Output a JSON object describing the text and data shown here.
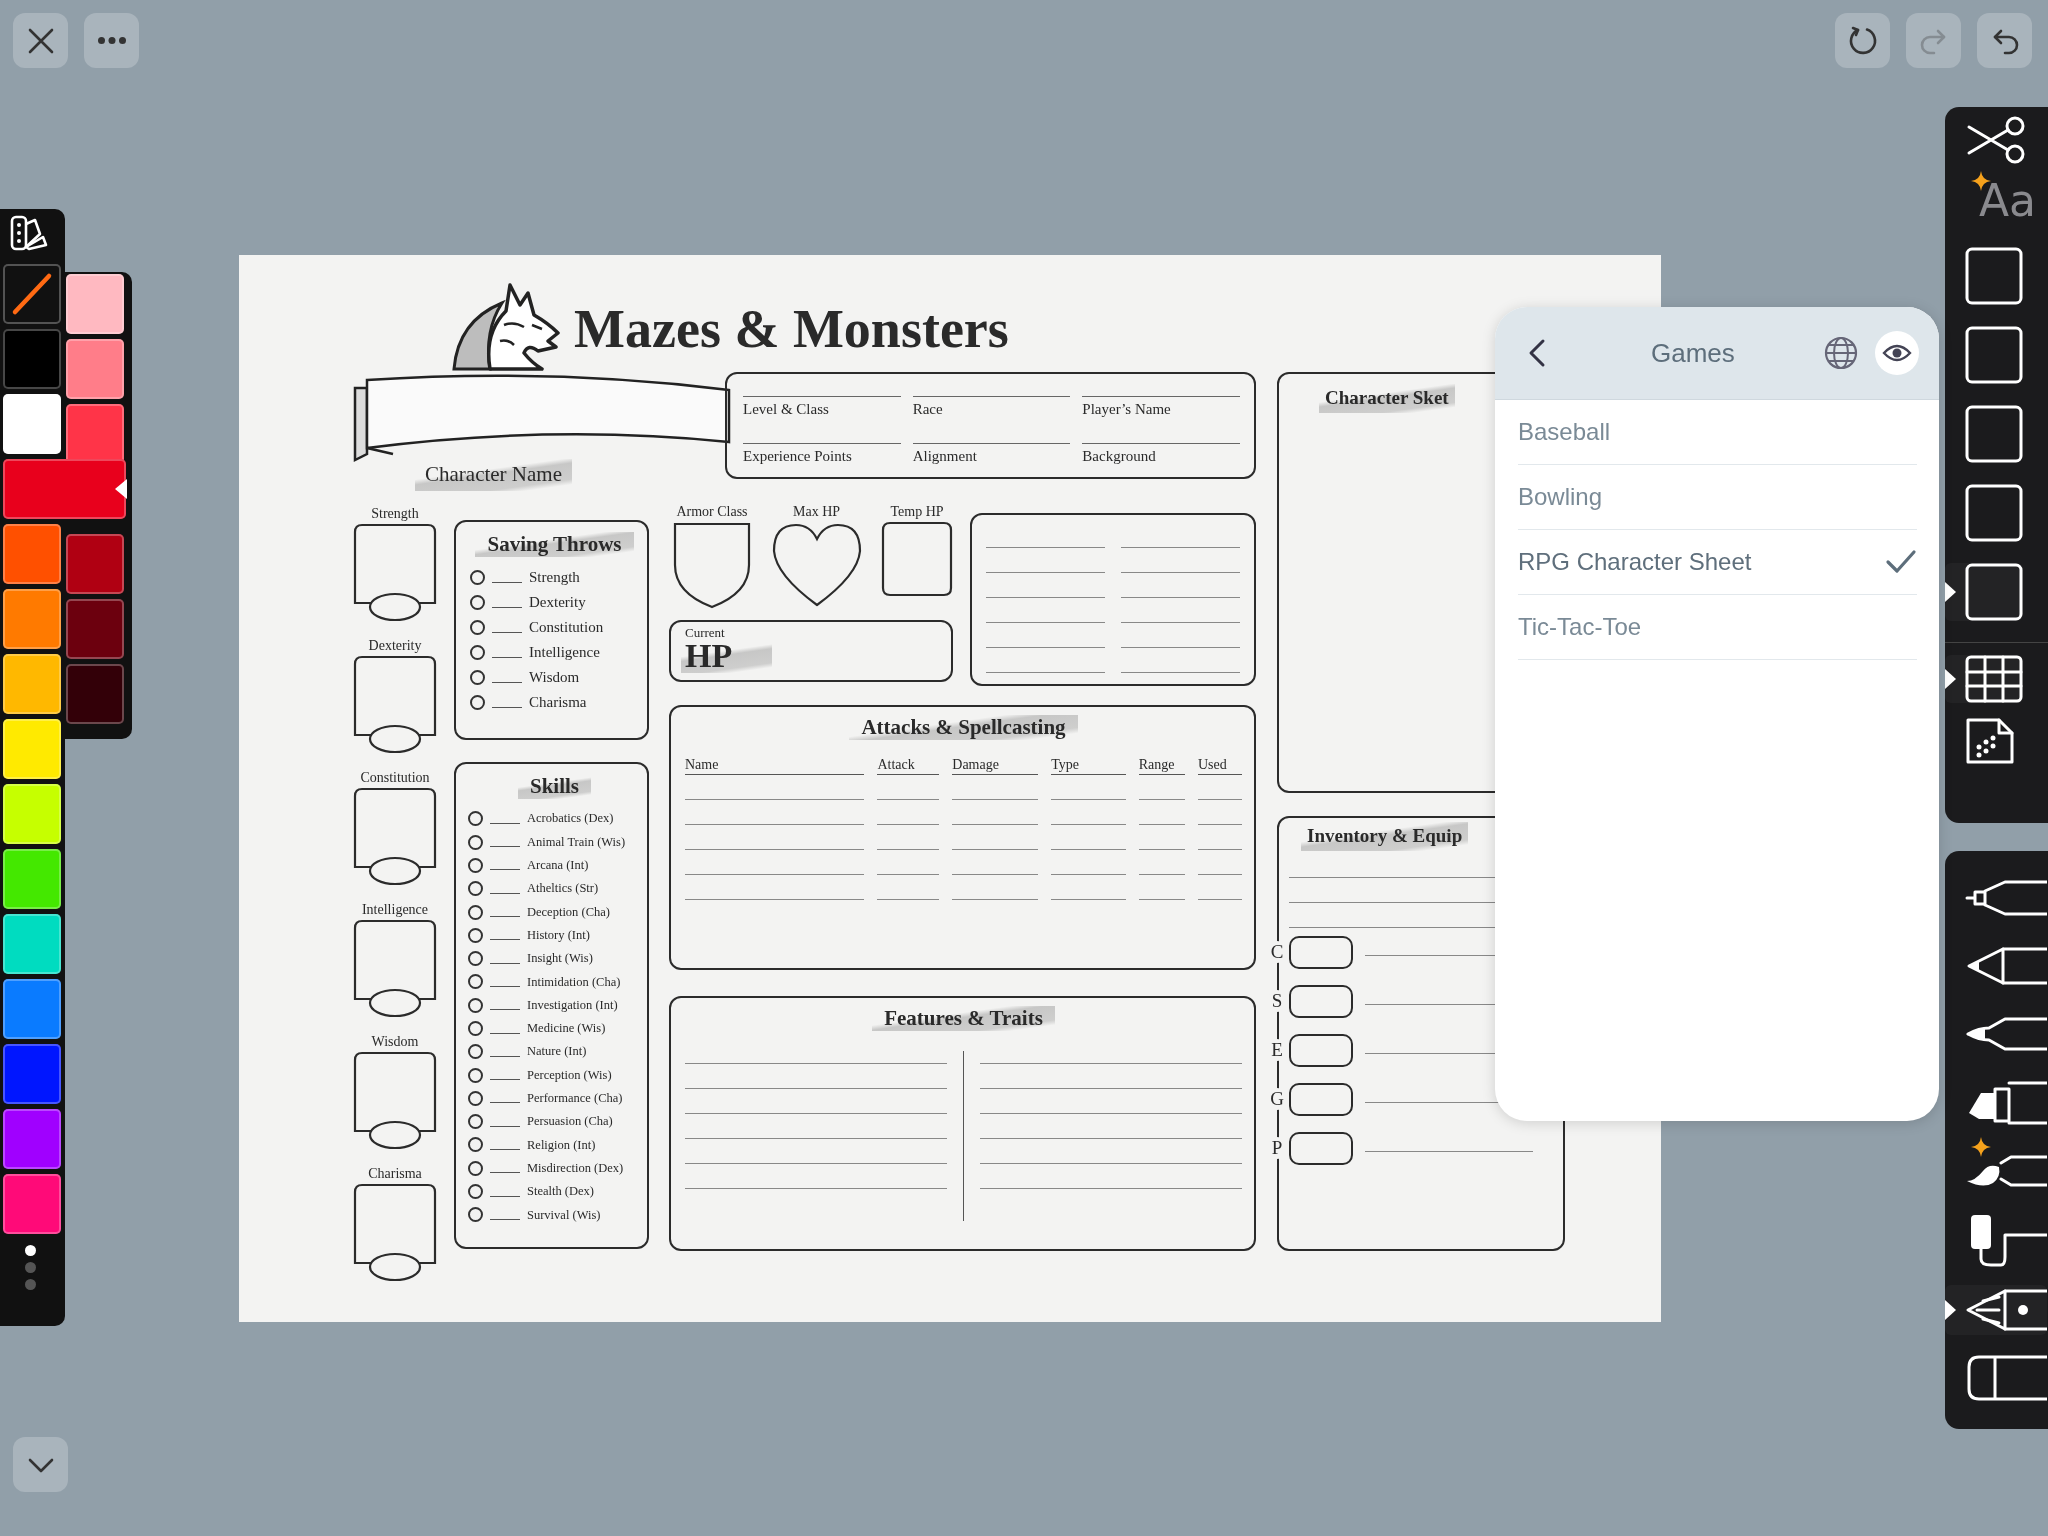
{
  "top_bar": {
    "left_buttons": [
      {
        "kind": "close"
      },
      {
        "kind": "more"
      }
    ],
    "right_buttons": [
      {
        "kind": "reset",
        "disabled": false
      },
      {
        "kind": "redo",
        "disabled": true
      },
      {
        "kind": "undo",
        "disabled": false
      }
    ]
  },
  "palette": {
    "swatches": [
      {
        "kind": "slash",
        "color": "#ff6a13",
        "selected": false
      },
      {
        "kind": "solid",
        "color": "#000000",
        "selected": false
      },
      {
        "kind": "solid",
        "color": "#ffffff",
        "selected": false
      },
      {
        "kind": "solid",
        "color": "#e8001c",
        "selected": true
      },
      {
        "kind": "solid",
        "color": "#ff5000",
        "selected": false
      },
      {
        "kind": "solid",
        "color": "#ff7a00",
        "selected": false
      },
      {
        "kind": "solid",
        "color": "#ffb800",
        "selected": false
      },
      {
        "kind": "solid",
        "color": "#ffea00",
        "selected": false
      },
      {
        "kind": "solid",
        "color": "#c6ff00",
        "selected": false
      },
      {
        "kind": "solid",
        "color": "#44e800",
        "selected": false
      },
      {
        "kind": "solid",
        "color": "#00dcc0",
        "selected": false
      },
      {
        "kind": "solid",
        "color": "#0a7bff",
        "selected": false
      },
      {
        "kind": "solid",
        "color": "#0016ff",
        "selected": false
      },
      {
        "kind": "solid",
        "color": "#a000ff",
        "selected": false
      },
      {
        "kind": "solid",
        "color": "#ff0a78",
        "selected": false
      }
    ],
    "shades": [
      {
        "color": "#ffb9c1"
      },
      {
        "color": "#ff7d89"
      },
      {
        "color": "#ff3448"
      },
      {
        "color": "#b00012"
      },
      {
        "color": "#6c000e"
      },
      {
        "color": "#330008"
      }
    ],
    "pages": [
      {
        "selected": true
      },
      {
        "selected": false
      },
      {
        "selected": false
      }
    ]
  },
  "sheet": {
    "title": "Mazes & Monsters",
    "character_name": "Character Name",
    "info_fields": [
      "Level & Class",
      "Race",
      "Player’s Name",
      "Experience Points",
      "Alignment",
      "Background"
    ],
    "abilities": [
      "Strength",
      "Dexterity",
      "Constitution",
      "Intelligence",
      "Wisdom",
      "Charisma"
    ],
    "saving_throws": {
      "title": "Saving Throws",
      "items": [
        "Strength",
        "Dexterity",
        "Constitution",
        "Intelligence",
        "Wisdom",
        "Charisma"
      ]
    },
    "skills": {
      "title": "Skills",
      "items": [
        "Acrobatics (Dex)",
        "Animal Train (Wis)",
        "Arcana (Int)",
        "Atheltics (Str)",
        "Deception (Cha)",
        "History (Int)",
        "Insight (Wis)",
        "Intimidation (Cha)",
        "Investigation (Int)",
        "Medicine (Wis)",
        "Nature (Int)",
        "Perception (Wis)",
        "Performance (Cha)",
        "Persuasion (Cha)",
        "Religion (Int)",
        "Misdirection (Dex)",
        "Stealth (Dex)",
        "Survival (Wis)"
      ]
    },
    "armor_class": "Armor Class",
    "max_hp": "Max HP",
    "temp_hp": "Temp HP",
    "current_hp": {
      "caption": "Current",
      "label": "HP"
    },
    "attacks": {
      "title": "Attacks & Spellcasting",
      "columns": [
        "Name",
        "Attack",
        "Damage",
        "Type",
        "Range",
        "Used"
      ]
    },
    "features": {
      "title": "Features & Traits"
    },
    "sketch": {
      "title": "Character Sket"
    },
    "inventory": {
      "title": "Inventory & Equip",
      "coins": [
        "C",
        "S",
        "E",
        "G",
        "P"
      ]
    }
  },
  "panel": {
    "title": "Games",
    "items": [
      {
        "label": "Baseball",
        "selected": false
      },
      {
        "label": "Bowling",
        "selected": false
      },
      {
        "label": "RPG Character Sheet",
        "selected": true
      },
      {
        "label": "Tic-Tac-Toe",
        "selected": false
      }
    ]
  },
  "tools": {
    "top": [
      {
        "kind": "scissors",
        "selected": false
      },
      {
        "kind": "text",
        "label": "Aa",
        "sparkle": true,
        "selected": false
      },
      {
        "kind": "frame",
        "selected": false
      },
      {
        "kind": "frame",
        "selected": false
      },
      {
        "kind": "frame",
        "selected": false
      },
      {
        "kind": "frame",
        "selected": false
      },
      {
        "kind": "frame",
        "selected": true
      },
      {
        "kind": "divider"
      },
      {
        "kind": "table",
        "selected": true
      },
      {
        "kind": "pattern",
        "selected": false
      }
    ],
    "pens": [
      {
        "kind": "fineliner",
        "selected": false
      },
      {
        "kind": "pencil",
        "selected": false
      },
      {
        "kind": "pen",
        "selected": false
      },
      {
        "kind": "marker",
        "selected": false
      },
      {
        "kind": "brush",
        "sparkle": true,
        "selected": false
      },
      {
        "kind": "roller",
        "selected": false
      },
      {
        "kind": "fountain",
        "selected": true
      },
      {
        "kind": "eraser",
        "selected": false
      }
    ]
  }
}
